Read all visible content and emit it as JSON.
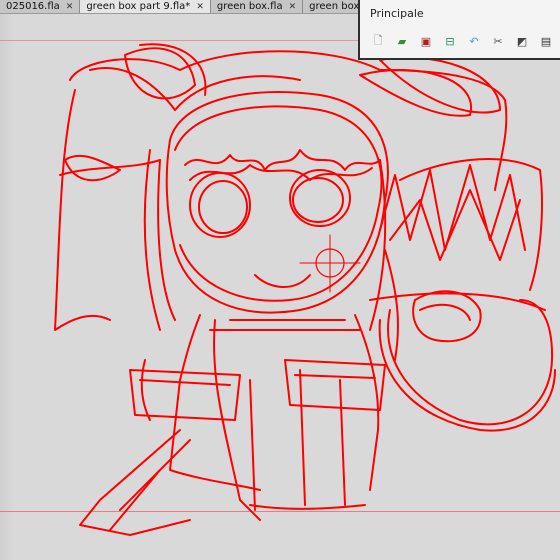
{
  "tabs": [
    {
      "label": "025016.fla"
    },
    {
      "label": "green box part 9.fla*"
    },
    {
      "label": "green box.fla"
    },
    {
      "label": "green box p"
    }
  ],
  "panel": {
    "title": "Principale",
    "icons": [
      "new-file-icon",
      "open-folder-icon",
      "save-icon",
      "save-as-icon",
      "undo-icon",
      "cut-icon",
      "copy-icon",
      "paste-icon"
    ]
  },
  "colors": {
    "sketch": "#ff0000",
    "stage": "#d9d9d9",
    "guide": "#e26a6a"
  }
}
